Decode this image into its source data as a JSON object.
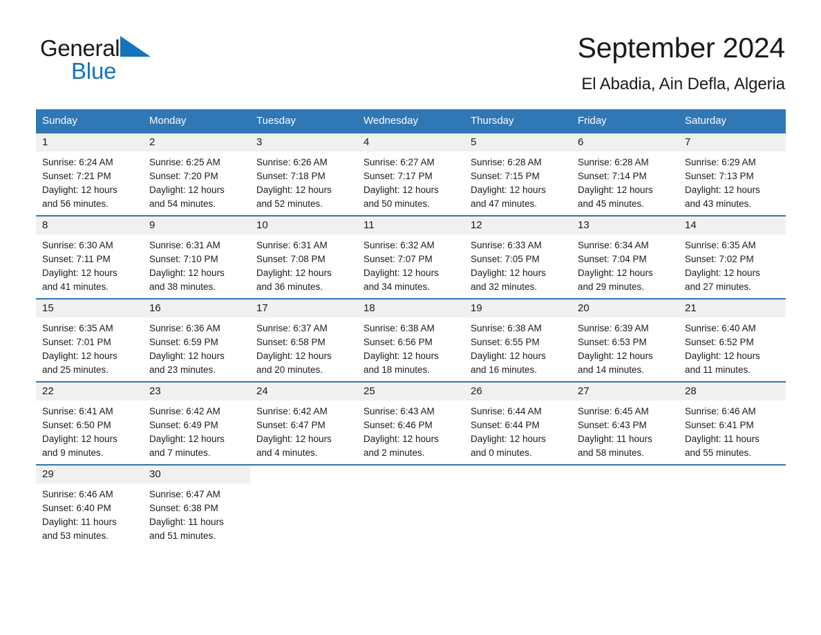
{
  "brand": {
    "name_part1": "General",
    "name_part2": "Blue",
    "triangle_color": "#1473bd",
    "logo_icon": "triangle-logo-icon"
  },
  "header": {
    "month_title": "September 2024",
    "location": "El Abadia, Ain Defla, Algeria"
  },
  "colors": {
    "header_blue": "#3077b5",
    "day_band_gray": "#f0f0f0",
    "text": "#1a1a1a",
    "brand_blue": "#1473bd"
  },
  "weekdays": [
    "Sunday",
    "Monday",
    "Tuesday",
    "Wednesday",
    "Thursday",
    "Friday",
    "Saturday"
  ],
  "weeks": [
    [
      {
        "day": "1",
        "sunrise": "Sunrise: 6:24 AM",
        "sunset": "Sunset: 7:21 PM",
        "daylight_line1": "Daylight: 12 hours",
        "daylight_line2": "and 56 minutes."
      },
      {
        "day": "2",
        "sunrise": "Sunrise: 6:25 AM",
        "sunset": "Sunset: 7:20 PM",
        "daylight_line1": "Daylight: 12 hours",
        "daylight_line2": "and 54 minutes."
      },
      {
        "day": "3",
        "sunrise": "Sunrise: 6:26 AM",
        "sunset": "Sunset: 7:18 PM",
        "daylight_line1": "Daylight: 12 hours",
        "daylight_line2": "and 52 minutes."
      },
      {
        "day": "4",
        "sunrise": "Sunrise: 6:27 AM",
        "sunset": "Sunset: 7:17 PM",
        "daylight_line1": "Daylight: 12 hours",
        "daylight_line2": "and 50 minutes."
      },
      {
        "day": "5",
        "sunrise": "Sunrise: 6:28 AM",
        "sunset": "Sunset: 7:15 PM",
        "daylight_line1": "Daylight: 12 hours",
        "daylight_line2": "and 47 minutes."
      },
      {
        "day": "6",
        "sunrise": "Sunrise: 6:28 AM",
        "sunset": "Sunset: 7:14 PM",
        "daylight_line1": "Daylight: 12 hours",
        "daylight_line2": "and 45 minutes."
      },
      {
        "day": "7",
        "sunrise": "Sunrise: 6:29 AM",
        "sunset": "Sunset: 7:13 PM",
        "daylight_line1": "Daylight: 12 hours",
        "daylight_line2": "and 43 minutes."
      }
    ],
    [
      {
        "day": "8",
        "sunrise": "Sunrise: 6:30 AM",
        "sunset": "Sunset: 7:11 PM",
        "daylight_line1": "Daylight: 12 hours",
        "daylight_line2": "and 41 minutes."
      },
      {
        "day": "9",
        "sunrise": "Sunrise: 6:31 AM",
        "sunset": "Sunset: 7:10 PM",
        "daylight_line1": "Daylight: 12 hours",
        "daylight_line2": "and 38 minutes."
      },
      {
        "day": "10",
        "sunrise": "Sunrise: 6:31 AM",
        "sunset": "Sunset: 7:08 PM",
        "daylight_line1": "Daylight: 12 hours",
        "daylight_line2": "and 36 minutes."
      },
      {
        "day": "11",
        "sunrise": "Sunrise: 6:32 AM",
        "sunset": "Sunset: 7:07 PM",
        "daylight_line1": "Daylight: 12 hours",
        "daylight_line2": "and 34 minutes."
      },
      {
        "day": "12",
        "sunrise": "Sunrise: 6:33 AM",
        "sunset": "Sunset: 7:05 PM",
        "daylight_line1": "Daylight: 12 hours",
        "daylight_line2": "and 32 minutes."
      },
      {
        "day": "13",
        "sunrise": "Sunrise: 6:34 AM",
        "sunset": "Sunset: 7:04 PM",
        "daylight_line1": "Daylight: 12 hours",
        "daylight_line2": "and 29 minutes."
      },
      {
        "day": "14",
        "sunrise": "Sunrise: 6:35 AM",
        "sunset": "Sunset: 7:02 PM",
        "daylight_line1": "Daylight: 12 hours",
        "daylight_line2": "and 27 minutes."
      }
    ],
    [
      {
        "day": "15",
        "sunrise": "Sunrise: 6:35 AM",
        "sunset": "Sunset: 7:01 PM",
        "daylight_line1": "Daylight: 12 hours",
        "daylight_line2": "and 25 minutes."
      },
      {
        "day": "16",
        "sunrise": "Sunrise: 6:36 AM",
        "sunset": "Sunset: 6:59 PM",
        "daylight_line1": "Daylight: 12 hours",
        "daylight_line2": "and 23 minutes."
      },
      {
        "day": "17",
        "sunrise": "Sunrise: 6:37 AM",
        "sunset": "Sunset: 6:58 PM",
        "daylight_line1": "Daylight: 12 hours",
        "daylight_line2": "and 20 minutes."
      },
      {
        "day": "18",
        "sunrise": "Sunrise: 6:38 AM",
        "sunset": "Sunset: 6:56 PM",
        "daylight_line1": "Daylight: 12 hours",
        "daylight_line2": "and 18 minutes."
      },
      {
        "day": "19",
        "sunrise": "Sunrise: 6:38 AM",
        "sunset": "Sunset: 6:55 PM",
        "daylight_line1": "Daylight: 12 hours",
        "daylight_line2": "and 16 minutes."
      },
      {
        "day": "20",
        "sunrise": "Sunrise: 6:39 AM",
        "sunset": "Sunset: 6:53 PM",
        "daylight_line1": "Daylight: 12 hours",
        "daylight_line2": "and 14 minutes."
      },
      {
        "day": "21",
        "sunrise": "Sunrise: 6:40 AM",
        "sunset": "Sunset: 6:52 PM",
        "daylight_line1": "Daylight: 12 hours",
        "daylight_line2": "and 11 minutes."
      }
    ],
    [
      {
        "day": "22",
        "sunrise": "Sunrise: 6:41 AM",
        "sunset": "Sunset: 6:50 PM",
        "daylight_line1": "Daylight: 12 hours",
        "daylight_line2": "and 9 minutes."
      },
      {
        "day": "23",
        "sunrise": "Sunrise: 6:42 AM",
        "sunset": "Sunset: 6:49 PM",
        "daylight_line1": "Daylight: 12 hours",
        "daylight_line2": "and 7 minutes."
      },
      {
        "day": "24",
        "sunrise": "Sunrise: 6:42 AM",
        "sunset": "Sunset: 6:47 PM",
        "daylight_line1": "Daylight: 12 hours",
        "daylight_line2": "and 4 minutes."
      },
      {
        "day": "25",
        "sunrise": "Sunrise: 6:43 AM",
        "sunset": "Sunset: 6:46 PM",
        "daylight_line1": "Daylight: 12 hours",
        "daylight_line2": "and 2 minutes."
      },
      {
        "day": "26",
        "sunrise": "Sunrise: 6:44 AM",
        "sunset": "Sunset: 6:44 PM",
        "daylight_line1": "Daylight: 12 hours",
        "daylight_line2": "and 0 minutes."
      },
      {
        "day": "27",
        "sunrise": "Sunrise: 6:45 AM",
        "sunset": "Sunset: 6:43 PM",
        "daylight_line1": "Daylight: 11 hours",
        "daylight_line2": "and 58 minutes."
      },
      {
        "day": "28",
        "sunrise": "Sunrise: 6:46 AM",
        "sunset": "Sunset: 6:41 PM",
        "daylight_line1": "Daylight: 11 hours",
        "daylight_line2": "and 55 minutes."
      }
    ],
    [
      {
        "day": "29",
        "sunrise": "Sunrise: 6:46 AM",
        "sunset": "Sunset: 6:40 PM",
        "daylight_line1": "Daylight: 11 hours",
        "daylight_line2": "and 53 minutes."
      },
      {
        "day": "30",
        "sunrise": "Sunrise: 6:47 AM",
        "sunset": "Sunset: 6:38 PM",
        "daylight_line1": "Daylight: 11 hours",
        "daylight_line2": "and 51 minutes."
      },
      {
        "day": "",
        "sunrise": "",
        "sunset": "",
        "daylight_line1": "",
        "daylight_line2": ""
      },
      {
        "day": "",
        "sunrise": "",
        "sunset": "",
        "daylight_line1": "",
        "daylight_line2": ""
      },
      {
        "day": "",
        "sunrise": "",
        "sunset": "",
        "daylight_line1": "",
        "daylight_line2": ""
      },
      {
        "day": "",
        "sunrise": "",
        "sunset": "",
        "daylight_line1": "",
        "daylight_line2": ""
      },
      {
        "day": "",
        "sunrise": "",
        "sunset": "",
        "daylight_line1": "",
        "daylight_line2": ""
      }
    ]
  ]
}
